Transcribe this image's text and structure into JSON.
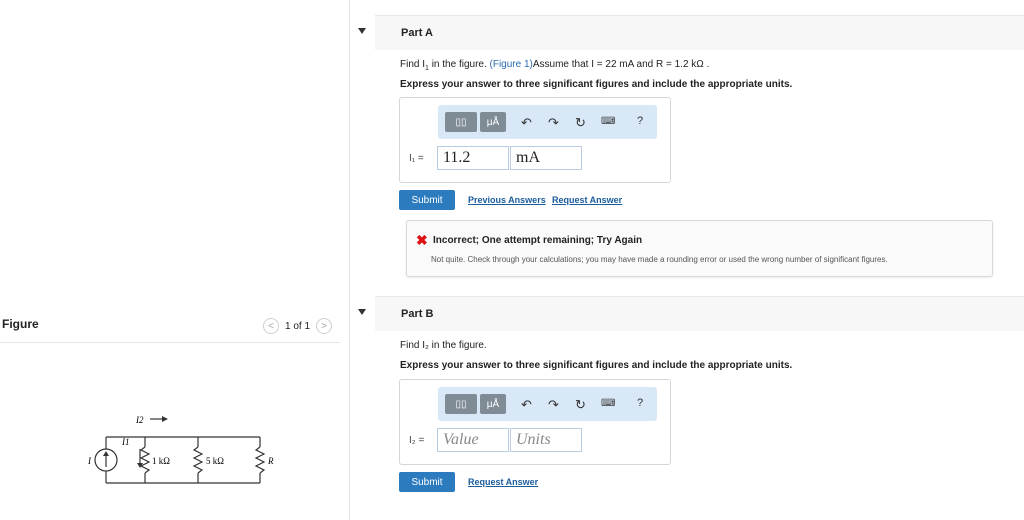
{
  "figure_panel": {
    "title": "Figure",
    "pager_text": "1 of 1",
    "prev_icon": "chevron-left-icon",
    "next_icon": "chevron-right-icon",
    "circuit": {
      "i2_label": "I2",
      "i1_label": "I1",
      "source_label": "I",
      "r1_label": "1 kΩ",
      "r2_label": "5 kΩ",
      "r3_label": "R"
    }
  },
  "part_a": {
    "title": "Part A",
    "question_prefix": "Find I",
    "question_sub": "1",
    "question_mid": " in the figure. ",
    "figure_link": "(Figure 1)",
    "question_rest": "Assume that I = 22 mA and R = 1.2 kΩ .",
    "instruction": "Express your answer to three significant figures and include the appropriate units.",
    "toolbar": {
      "mu_label": "μÅ",
      "help": "?"
    },
    "answer_label": "I₁ =",
    "value": "11.2",
    "units": "mA",
    "submit_label": "Submit",
    "previous_answers_label": "Previous Answers",
    "request_answer_label": "Request Answer",
    "feedback": {
      "title": "Incorrect; One attempt remaining; Try Again",
      "message": "Not quite. Check through your calculations; you may have made a rounding error or used the wrong number of significant figures."
    }
  },
  "part_b": {
    "title": "Part B",
    "question": "Find I₂ in the figure.",
    "instruction": "Express your answer to three significant figures and include the appropriate units.",
    "toolbar": {
      "mu_label": "μÅ",
      "help": "?"
    },
    "answer_label": "I₂ =",
    "value_placeholder": "Value",
    "units_placeholder": "Units",
    "submit_label": "Submit",
    "request_answer_label": "Request Answer"
  },
  "colors": {
    "accent": "#2c7bbf",
    "toolbar_bg": "#d8e8f7",
    "error": "#dd1111"
  }
}
